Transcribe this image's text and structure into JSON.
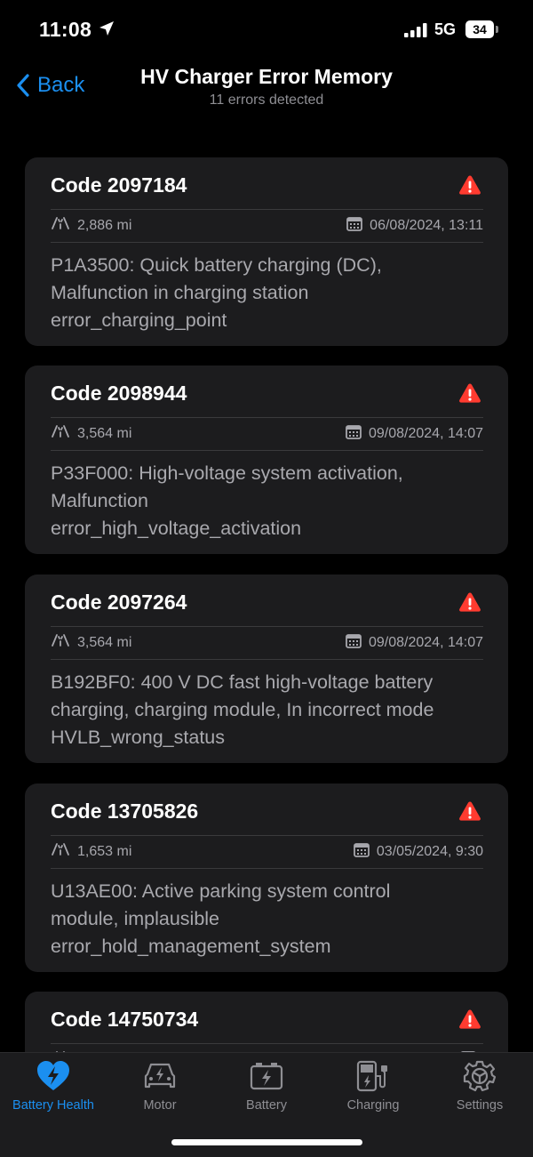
{
  "status_bar": {
    "time": "11:08",
    "network": "5G",
    "battery": "34"
  },
  "nav": {
    "back_label": "Back",
    "title": "HV Charger Error Memory",
    "subtitle": "11 errors detected"
  },
  "errors": [
    {
      "code": "Code 2097184",
      "mileage": "2,886 mi",
      "datetime": "06/08/2024, 13:11",
      "description_lines": [
        "P1A3500: Quick battery charging (DC),",
        "Malfunction in charging station",
        "error_charging_point"
      ]
    },
    {
      "code": "Code 2098944",
      "mileage": "3,564 mi",
      "datetime": "09/08/2024, 14:07",
      "description_lines": [
        "P33F000: High-voltage system activation,",
        "Malfunction",
        "error_high_voltage_activation"
      ]
    },
    {
      "code": "Code 2097264",
      "mileage": "3,564 mi",
      "datetime": "09/08/2024, 14:07",
      "description_lines": [
        "B192BF0: 400 V DC fast high-voltage battery",
        "charging, charging module, In incorrect mode",
        "HVLB_wrong_status"
      ]
    },
    {
      "code": "Code 13705826",
      "mileage": "1,653 mi",
      "datetime": "03/05/2024, 9:30",
      "description_lines": [
        "U13AE00: Active parking system control",
        "module, implausible",
        "error_hold_management_system"
      ]
    },
    {
      "code": "Code 14750734",
      "mileage": "",
      "datetime": "",
      "description_lines": [
        "",
        "",
        ""
      ]
    }
  ],
  "tabs": [
    {
      "label": "Battery Health",
      "icon": "heart-bolt-icon",
      "active": true
    },
    {
      "label": "Motor",
      "icon": "car-bolt-icon",
      "active": false
    },
    {
      "label": "Battery",
      "icon": "battery-bolt-icon",
      "active": false
    },
    {
      "label": "Charging",
      "icon": "ev-charger-icon",
      "active": false
    },
    {
      "label": "Settings",
      "icon": "gear-icon",
      "active": false
    }
  ],
  "colors": {
    "accent": "#1b8ff0",
    "warning": "#ff3b30",
    "card": "#1c1c1e",
    "background": "#000000"
  }
}
